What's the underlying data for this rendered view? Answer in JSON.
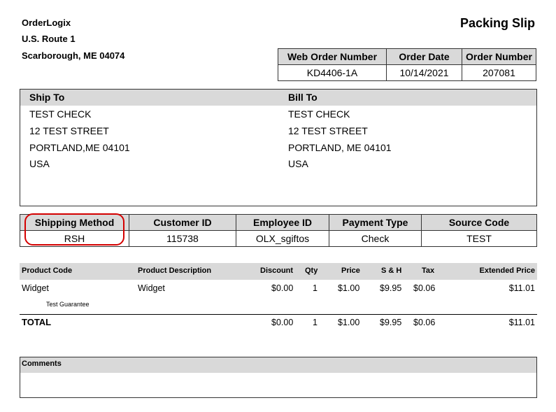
{
  "company": {
    "name": "OrderLogix",
    "street": "U.S. Route 1",
    "city": "Scarborough, ME 04074"
  },
  "doc_title": "Packing Slip",
  "order_info": {
    "headers": [
      "Web Order Number",
      "Order Date",
      "Order Number"
    ],
    "values": [
      "KD4406-1A",
      "10/14/2021",
      "207081"
    ]
  },
  "ship_to": {
    "label": "Ship To",
    "lines": [
      "TEST  CHECK",
      "12 TEST STREET",
      "PORTLAND,ME 04101",
      "USA"
    ]
  },
  "bill_to": {
    "label": "Bill To",
    "lines": [
      "TEST CHECK",
      "12 TEST STREET",
      "PORTLAND, ME 04101",
      "USA"
    ]
  },
  "shipping": {
    "headers": [
      "Shipping Method",
      "Customer ID",
      "Employee ID",
      "Payment Type",
      "Source Code"
    ],
    "values": [
      "RSH",
      "115738",
      "OLX_sgiftos",
      "Check",
      "TEST"
    ]
  },
  "products": {
    "headers": [
      "Product Code",
      "Product Description",
      "Discount",
      "Qty",
      "Price",
      "S & H",
      "Tax",
      "Extended Price"
    ],
    "rows": [
      {
        "code": "Widget",
        "description": "Widget",
        "note": "Test Guarantee",
        "discount": "$0.00",
        "qty": "1",
        "price": "$1.00",
        "sh": "$9.95",
        "tax": "$0.06",
        "extended": "$11.01"
      }
    ],
    "total": {
      "label": "TOTAL",
      "discount": "$0.00",
      "qty": "1",
      "price": "$1.00",
      "sh": "$9.95",
      "tax": "$0.06",
      "extended": "$11.01"
    }
  },
  "comments": {
    "label": "Comments"
  },
  "colors": {
    "header_band": "#d9d9d9",
    "highlight": "#d40000"
  }
}
